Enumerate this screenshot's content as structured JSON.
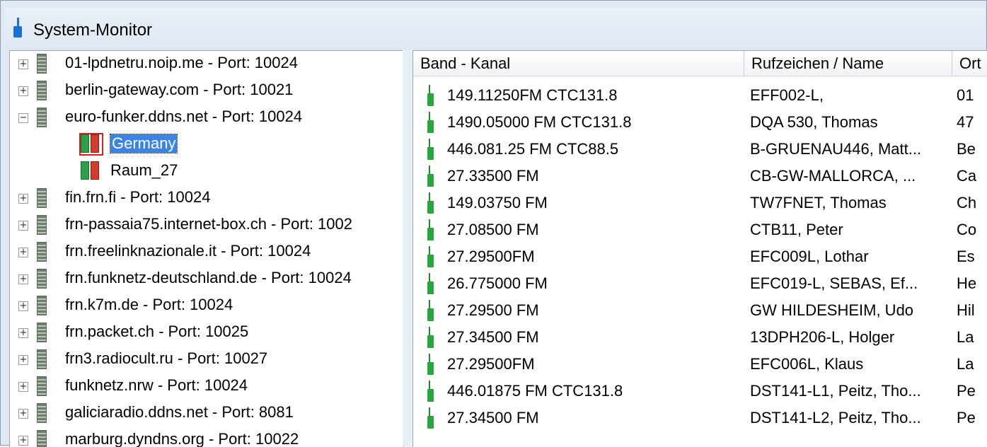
{
  "window": {
    "title": "System-Monitor"
  },
  "tree": {
    "items": [
      {
        "label": "01-lpdnetru.noip.me - Port: 10024",
        "expander": "+"
      },
      {
        "label": "berlin-gateway.com - Port: 10021",
        "expander": "+"
      },
      {
        "label": "euro-funker.ddns.net - Port: 10024",
        "expander": "−"
      },
      {
        "label": "Germany",
        "child": true,
        "selected": true
      },
      {
        "label": "Raum_27",
        "child": true
      },
      {
        "label": "fin.frn.fi - Port: 10024",
        "expander": "+"
      },
      {
        "label": "frn-passaia75.internet-box.ch - Port: 1002",
        "expander": "+"
      },
      {
        "label": "frn.freelinknazionale.it - Port: 10024",
        "expander": "+"
      },
      {
        "label": "frn.funknetz-deutschland.de - Port: 10024",
        "expander": "+"
      },
      {
        "label": "frn.k7m.de - Port: 10024",
        "expander": "+"
      },
      {
        "label": "frn.packet.ch - Port: 10025",
        "expander": "+"
      },
      {
        "label": "frn3.radiocult.ru - Port: 10027",
        "expander": "+"
      },
      {
        "label": "funknetz.nrw - Port: 10024",
        "expander": "+"
      },
      {
        "label": "galiciaradio.ddns.net - Port: 8081",
        "expander": "+"
      },
      {
        "label": "marburg.dyndns.org - Port: 10022",
        "expander": "+"
      }
    ]
  },
  "list": {
    "columns": [
      "Band - Kanal",
      "Rufzeichen / Name",
      "Ort"
    ],
    "rows": [
      [
        "149.11250FM CTC131.8",
        "EFF002-L,",
        "01"
      ],
      [
        "1490.05000 FM CTC131.8",
        "DQA 530, Thomas",
        "47"
      ],
      [
        "446.081.25 FM CTC88.5",
        "B-GRUENAU446, Matt...",
        "Be"
      ],
      [
        "27.33500 FM",
        "CB-GW-MALLORCA, ...",
        "Ca"
      ],
      [
        "149.03750 FM",
        "TW7FNET, Thomas",
        "Ch"
      ],
      [
        "27.08500 FM",
        "CTB11, Peter",
        "Co"
      ],
      [
        "27.29500FM",
        "EFC009L, Lothar",
        "Es"
      ],
      [
        "26.775000 FM",
        "EFC019-L, SEBAS, Ef...",
        "He"
      ],
      [
        "27.29500 FM",
        "GW HILDESHEIM, Udo",
        "Hil"
      ],
      [
        "27.34500 FM",
        "13DPH206-L, Holger",
        "La"
      ],
      [
        "27.29500FM",
        "EFC006L, Klaus",
        "La"
      ],
      [
        "446.01875 FM CTC131.8",
        "DST141-L1, Peitz, Tho...",
        "Pe"
      ],
      [
        "27.34500 FM",
        "DST141-L2, Peitz, Tho...",
        "Pe"
      ]
    ]
  },
  "icons": {
    "app": "radio-icon",
    "server": "server-icon",
    "room": "room-icon",
    "row": "radio-icon"
  }
}
